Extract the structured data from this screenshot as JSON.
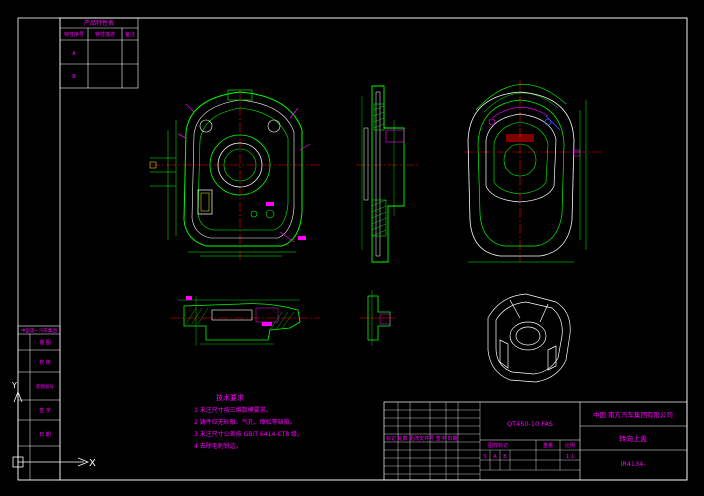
{
  "features_table": {
    "title": "产品特性表",
    "headers": [
      "特性序号",
      "特性描述",
      "备注"
    ],
    "rows": [
      {
        "id": "A",
        "desc": "",
        "note": ""
      },
      {
        "id": "B",
        "desc": "",
        "note": ""
      }
    ]
  },
  "left_stamp": {
    "title": "中国第一汽车集团",
    "rows": [
      "描 图",
      "校 核",
      "底图总号",
      "签 字",
      "日 期"
    ]
  },
  "technical_requirements": {
    "title": "技术要求",
    "items": [
      "1 未注尺寸按三维数模要求。",
      "2 铸件应无砂眼、气孔、缩松等缺陷。",
      "3 未注尺寸公差按 GB/T 6414-CT8 级。",
      "4 去除毛刺锐边。"
    ]
  },
  "title_block": {
    "material": "QT450-10 FAS",
    "company": "中国·南方汽车集团有限公司",
    "part_name": "转向上盖",
    "drawing_no": "IR4134-",
    "process_row": "标记 处数 更改文件号 签字 日期",
    "scale_labels": [
      "图样标记",
      "重量",
      "比例"
    ],
    "scale_value": "1:1",
    "marks": [
      "S",
      "A",
      "B"
    ]
  },
  "ucs": {
    "y_label": "Y",
    "x_label": "X"
  },
  "colors": {
    "background": "#000000",
    "outline": "#00ff00",
    "frame": "#ffffff",
    "dimension": "#ff00ff",
    "centerline": "#ff0000",
    "hidden": "#ffff00",
    "section": "#00ffff",
    "accent_blue": "#3b5bff"
  }
}
